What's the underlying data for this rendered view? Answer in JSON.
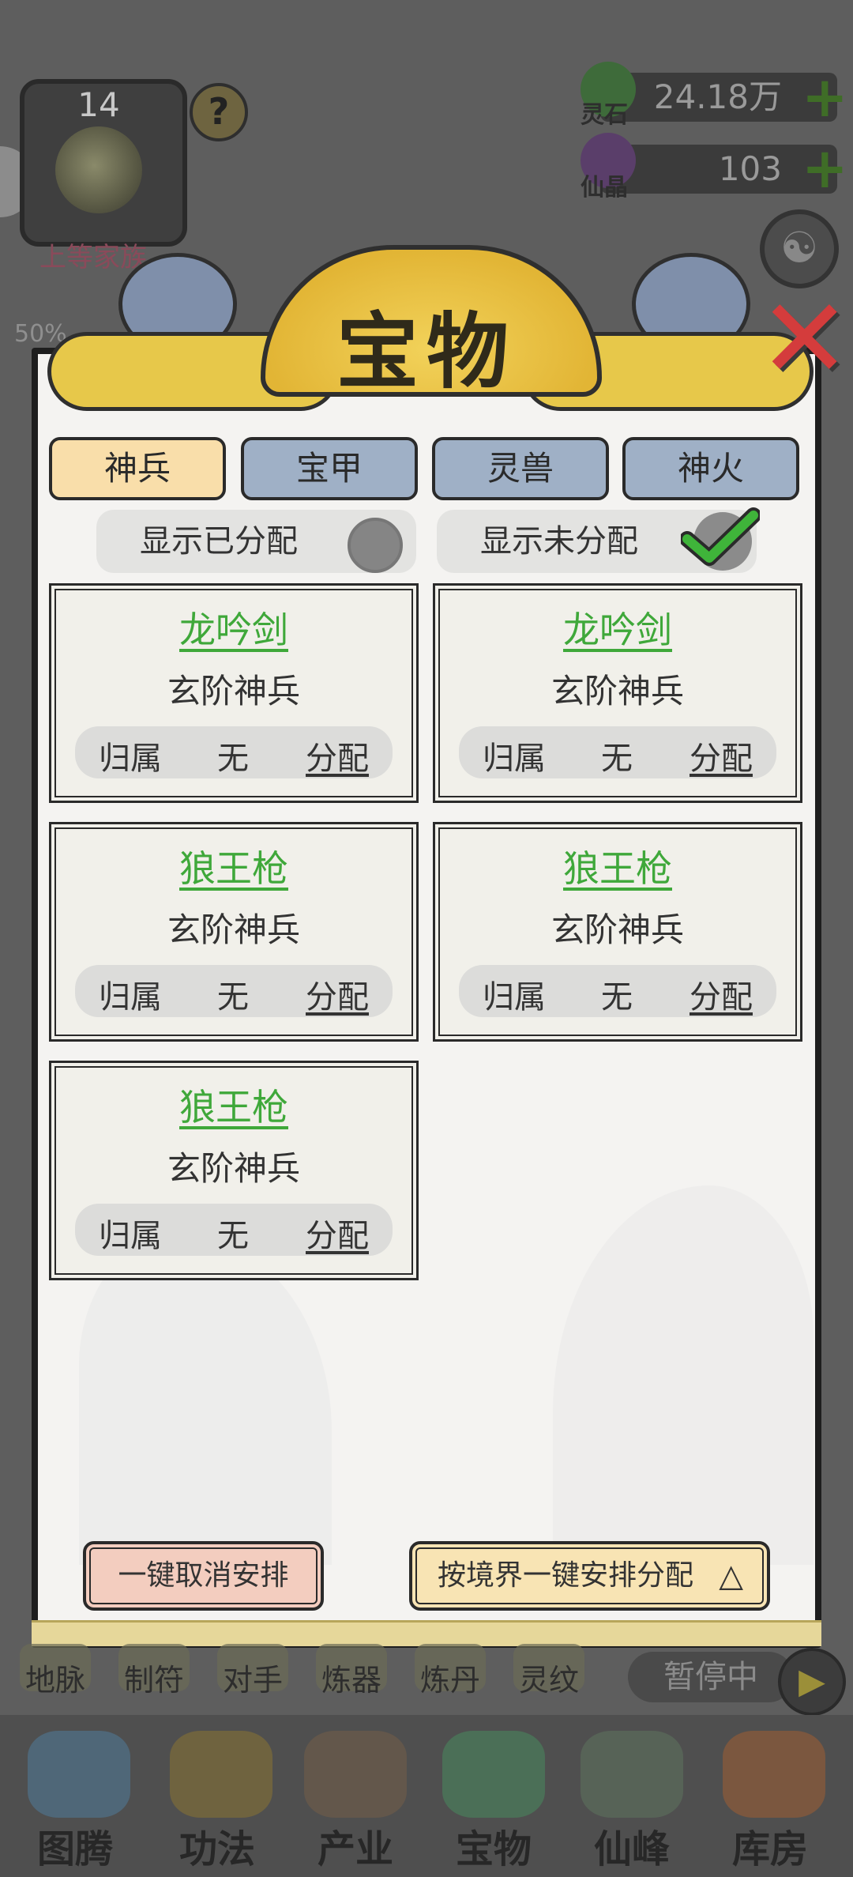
{
  "hud": {
    "level": "14",
    "help_symbol": "?",
    "family_rank": "上等家族",
    "progress_percent": "50%",
    "resources": [
      {
        "label": "灵石",
        "value": "24.18万",
        "icon": "spirit-stone-icon"
      },
      {
        "label": "仙晶",
        "value": "103",
        "icon": "immortal-crystal-icon"
      }
    ],
    "plus_symbol": "+"
  },
  "dialog": {
    "title": "宝物",
    "close_symbol": "✕",
    "tabs": [
      {
        "label": "神兵",
        "active": true
      },
      {
        "label": "宝甲",
        "active": false
      },
      {
        "label": "灵兽",
        "active": false
      },
      {
        "label": "神火",
        "active": false
      }
    ],
    "filters": {
      "show_assigned": {
        "label": "显示已分配",
        "checked": false
      },
      "show_unassigned": {
        "label": "显示未分配",
        "checked": true
      }
    },
    "treasures": [
      {
        "name": "龙吟剑",
        "grade": "玄阶神兵",
        "owner_label": "归属",
        "owner": "无",
        "action": "分配"
      },
      {
        "name": "龙吟剑",
        "grade": "玄阶神兵",
        "owner_label": "归属",
        "owner": "无",
        "action": "分配"
      },
      {
        "name": "狼王枪",
        "grade": "玄阶神兵",
        "owner_label": "归属",
        "owner": "无",
        "action": "分配"
      },
      {
        "name": "狼王枪",
        "grade": "玄阶神兵",
        "owner_label": "归属",
        "owner": "无",
        "action": "分配"
      },
      {
        "name": "狼王枪",
        "grade": "玄阶神兵",
        "owner_label": "归属",
        "owner": "无",
        "action": "分配"
      }
    ],
    "cancel_all_label": "一键取消安排",
    "auto_assign_label": "按境界一键安排分配"
  },
  "sub_nav": {
    "items": [
      "地脉",
      "制符",
      "对手",
      "炼器",
      "炼丹",
      "灵纹"
    ],
    "pause_label": "暂停中"
  },
  "main_nav": {
    "items": [
      "图腾",
      "功法",
      "产业",
      "宝物",
      "仙峰",
      "库房"
    ]
  },
  "colors": {
    "treasure_name": "#3fa83a",
    "active_tab": "#f9deaa",
    "inactive_tab": "#9fb0c6",
    "title_gold": "#e7c84a",
    "close_red": "#d43c3c",
    "check_green": "#3fb43a"
  }
}
